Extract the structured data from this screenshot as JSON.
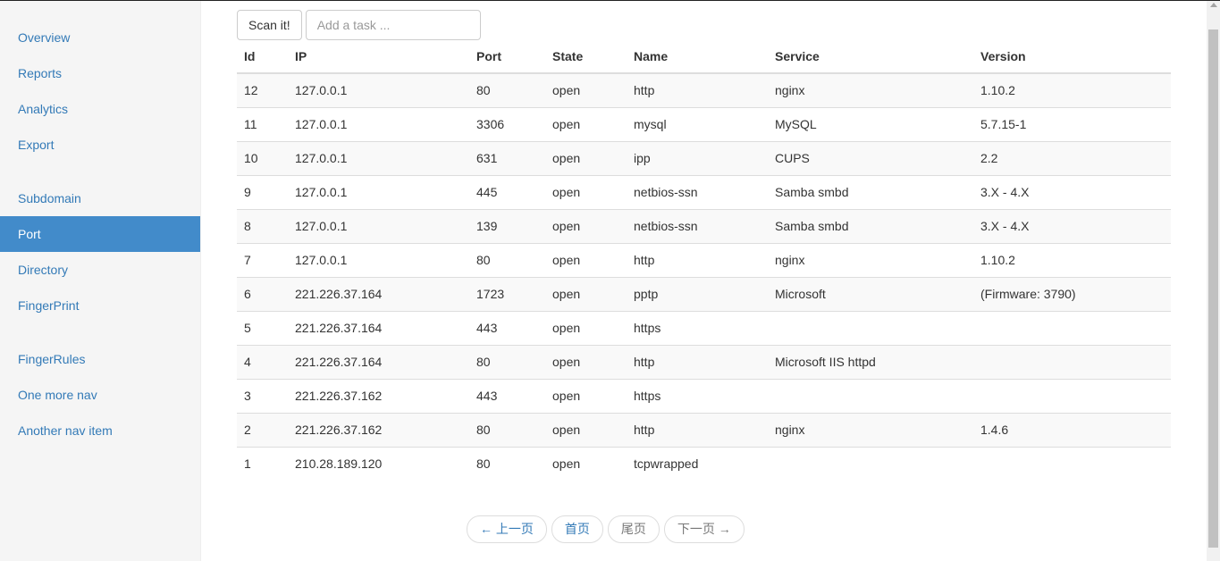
{
  "sidebar": {
    "groups": [
      [
        {
          "label": "Overview"
        },
        {
          "label": "Reports"
        },
        {
          "label": "Analytics"
        },
        {
          "label": "Export"
        }
      ],
      [
        {
          "label": "Subdomain"
        },
        {
          "label": "Port",
          "active": true
        },
        {
          "label": "Directory"
        },
        {
          "label": "FingerPrint"
        }
      ],
      [
        {
          "label": "FingerRules"
        },
        {
          "label": "One more nav"
        },
        {
          "label": "Another nav item"
        }
      ]
    ]
  },
  "toolbar": {
    "scan_label": "Scan it!",
    "task_placeholder": "Add a task ..."
  },
  "table": {
    "headers": [
      "Id",
      "IP",
      "Port",
      "State",
      "Name",
      "Service",
      "Version"
    ],
    "rows": [
      [
        "12",
        "127.0.0.1",
        "80",
        "open",
        "http",
        "nginx",
        "1.10.2"
      ],
      [
        "11",
        "127.0.0.1",
        "3306",
        "open",
        "mysql",
        "MySQL",
        "5.7.15-1"
      ],
      [
        "10",
        "127.0.0.1",
        "631",
        "open",
        "ipp",
        "CUPS",
        "2.2"
      ],
      [
        "9",
        "127.0.0.1",
        "445",
        "open",
        "netbios-ssn",
        "Samba smbd",
        "3.X - 4.X"
      ],
      [
        "8",
        "127.0.0.1",
        "139",
        "open",
        "netbios-ssn",
        "Samba smbd",
        "3.X - 4.X"
      ],
      [
        "7",
        "127.0.0.1",
        "80",
        "open",
        "http",
        "nginx",
        "1.10.2"
      ],
      [
        "6",
        "221.226.37.164",
        "1723",
        "open",
        "pptp",
        "Microsoft",
        "(Firmware: 3790)"
      ],
      [
        "5",
        "221.226.37.164",
        "443",
        "open",
        "https",
        "",
        ""
      ],
      [
        "4",
        "221.226.37.164",
        "80",
        "open",
        "http",
        "Microsoft IIS httpd",
        ""
      ],
      [
        "3",
        "221.226.37.162",
        "443",
        "open",
        "https",
        "",
        ""
      ],
      [
        "2",
        "221.226.37.162",
        "80",
        "open",
        "http",
        "nginx",
        "1.4.6"
      ],
      [
        "1",
        "210.28.189.120",
        "80",
        "open",
        "tcpwrapped",
        "",
        ""
      ]
    ]
  },
  "pager": {
    "prev": "← 上一页",
    "first": "首页",
    "last": "尾页",
    "next": "下一页 →"
  },
  "colors": {
    "accent": "#428bca",
    "link": "#337ab7"
  }
}
